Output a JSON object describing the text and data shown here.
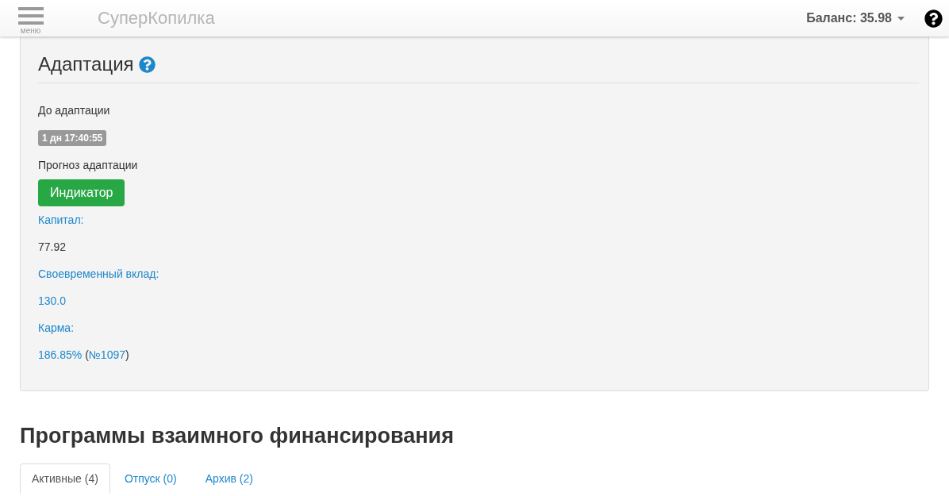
{
  "header": {
    "menu_label": "меню",
    "title": "СуперКопилка",
    "balance": "Баланс: 35.98"
  },
  "adaptation": {
    "title": "Адаптация",
    "countdown_label": "До адаптации",
    "countdown": "1 дн 17:40:55",
    "forecast_label": "Прогноз адаптации",
    "forecast_button": "Индикатор",
    "fields": [
      {
        "label": "Капитал:",
        "value": [
          {
            "text": "77.92",
            "kind": "plain"
          }
        ]
      },
      {
        "label": "Своевременный вклад:",
        "value": [
          {
            "text": "130.0",
            "kind": "link"
          }
        ]
      },
      {
        "label": "Карма:",
        "value": [
          {
            "text": "186.85%",
            "kind": "link"
          },
          {
            "text": " (",
            "kind": "plain"
          },
          {
            "text": "№1097",
            "kind": "link"
          },
          {
            "text": ")",
            "kind": "plain"
          }
        ]
      }
    ]
  },
  "programs": {
    "title": "Программы взаимного финансирования",
    "tabs": [
      {
        "label": "Активные (4)",
        "selected": true
      },
      {
        "label": "Отпуск (0)",
        "selected": false
      },
      {
        "label": "Архив (2)",
        "selected": false
      }
    ]
  }
}
